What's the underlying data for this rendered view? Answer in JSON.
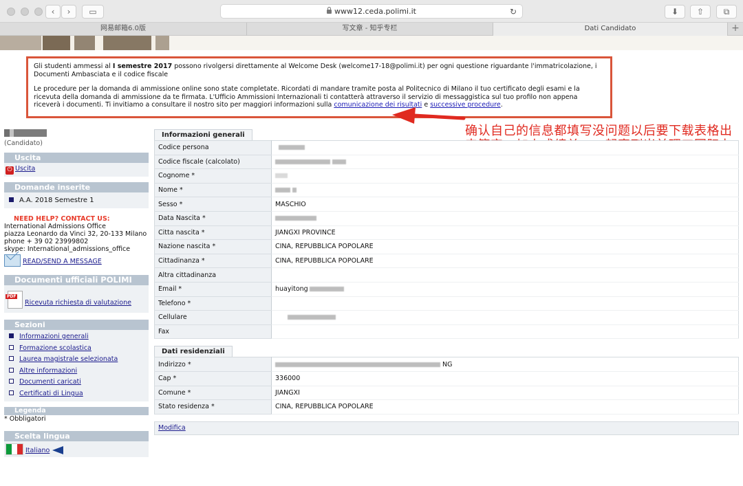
{
  "browser": {
    "url": "www12.ceda.polimi.it",
    "tabs": [
      "网易邮箱6.0版",
      "写文章 - 知乎专栏",
      "Dati Candidato"
    ]
  },
  "notice": {
    "p1_a": "Gli studenti ammessi al ",
    "p1_bold": "I semestre 2017",
    "p1_b": " possono rivolgersi direttamente al Welcome Desk (welcome17-18@polimi.it) per ogni questione riguardante l'immatricolazione, i Documenti Ambasciata e il codice fiscale",
    "p2_a": "Le procedure per la domanda di ammissione online sono state completate. Ricordati di mandare tramite posta al Politecnico di Milano il tuo certificato degli esami e la ricevuta della domanda di ammissione da te firmata. L'Ufficio Ammissioni Internazionali ti contatterà attraverso il servizio di messaggistica sul tuo profilo non appena riceverà i documenti. Ti invitiamo a consultare il nostro sito per maggiori informazioni sulla ",
    "link1": "comunicazione dei risultati",
    "p2_b": " e ",
    "link2": "successive procedure",
    "p2_c": "."
  },
  "annotation": "确认自己的信息都填写没问题以后要下载表格出来签字，加上成绩单，一起寄到米兰理工国际办公室，寄到了以后就会开始审核",
  "sidebar": {
    "role": "(Candidato)",
    "uscita_title": "Uscita",
    "uscita_link": "Uscita",
    "domande_title": "Domande inserite",
    "domande_item": "A.A. 2018 Semestre 1",
    "help_title": "NEED HELP? CONTACT US:",
    "help_lines": [
      "International Admissions Office",
      "piazza Leonardo da Vinci 32, 20-133 Milano",
      "phone + 39 02 23999802",
      "skype: International_admissions_office"
    ],
    "message_link": "READ/SEND A MESSAGE",
    "documenti_title": "Documenti ufficiali POLIMI",
    "documenti_link": "Ricevuta richiesta di valutazione",
    "sezioni_title": "Sezioni",
    "sezioni": [
      "Informazioni generali",
      "Formazione scolastica",
      "Laurea magistrale selezionata",
      "Altre informazioni",
      "Documenti caricati",
      "Certificati di Lingua"
    ],
    "legenda_title": "Legenda",
    "legenda_text": "* Obbligatori",
    "lingua_title": "Scelta lingua",
    "lingua_link": "Italiano"
  },
  "generali": {
    "title": "Informazioni generali",
    "rows": [
      {
        "label": "Codice persona",
        "value": ""
      },
      {
        "label": "Codice fiscale (calcolato)",
        "value": ""
      },
      {
        "label": "Cognome *",
        "value": ""
      },
      {
        "label": "Nome *",
        "value": ""
      },
      {
        "label": "Sesso *",
        "value": "MASCHIO"
      },
      {
        "label": "Data Nascita *",
        "value": ""
      },
      {
        "label": "Citta nascita *",
        "value": "JIANGXI PROVINCE"
      },
      {
        "label": "Nazione nascita *",
        "value": "CINA, REPUBBLICA POPOLARE"
      },
      {
        "label": "Cittadinanza *",
        "value": "CINA, REPUBBLICA POPOLARE"
      },
      {
        "label": "Altra cittadinanza",
        "value": ""
      },
      {
        "label": "Email *",
        "value": "huayitong"
      },
      {
        "label": "Telefono *",
        "value": ""
      },
      {
        "label": "Cellulare",
        "value": ""
      },
      {
        "label": "Fax",
        "value": ""
      }
    ]
  },
  "residenziali": {
    "title": "Dati residenziali",
    "rows": [
      {
        "label": "Indirizzo *",
        "value": "NG"
      },
      {
        "label": "Cap *",
        "value": "336000"
      },
      {
        "label": "Comune *",
        "value": "JIANGXI"
      },
      {
        "label": "Stato residenza *",
        "value": "CINA, REPUBBLICA POPOLARE"
      }
    ]
  },
  "modifica": "Modifica"
}
